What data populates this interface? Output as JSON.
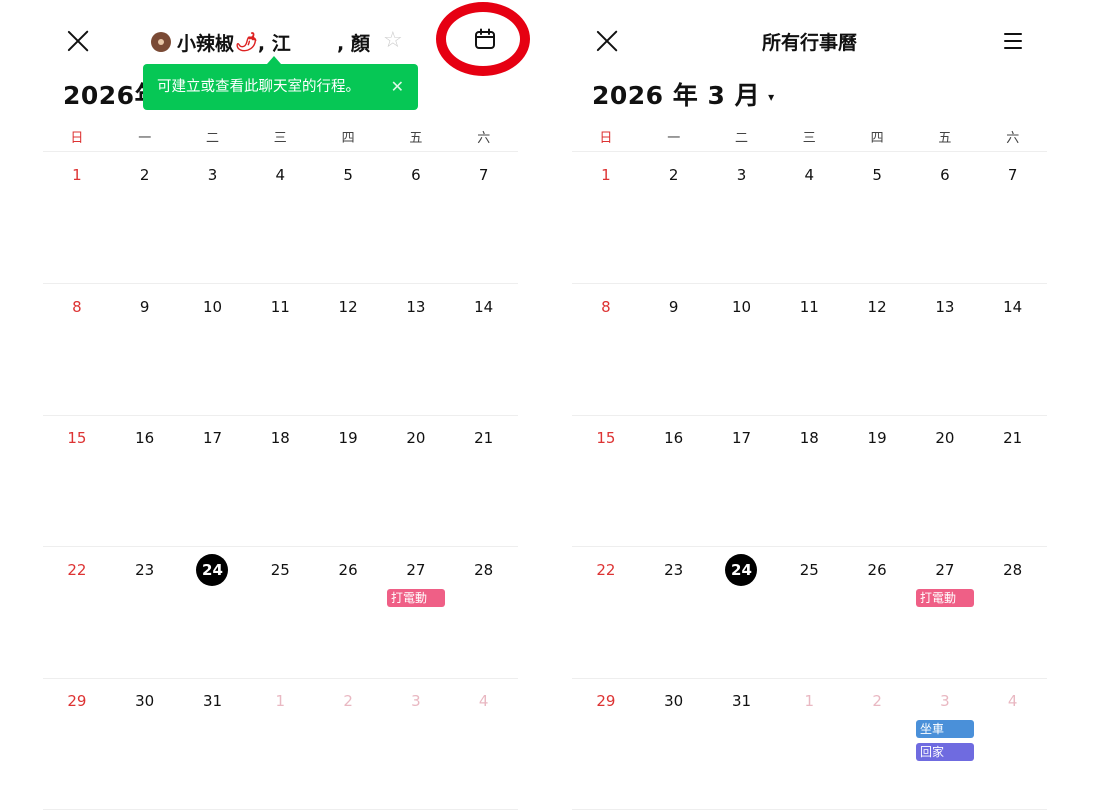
{
  "colors": {
    "today_bg": "#000000",
    "sunday": "#dd3333",
    "other_month": "#e9b8c2",
    "tooltip_bg": "#06c755",
    "highlight_ring": "#e60012",
    "event_pink": "#ef5f86",
    "event_blue": "#4a90d9",
    "event_purple": "#6f6be0"
  },
  "left": {
    "title": {
      "avatar_icon": "avatar-icon",
      "name1": "小辣椒",
      "pepper_icon": "🌶",
      "rest": ", 江       , 顏"
    },
    "star_icon": "star-icon",
    "calendar_icon": "calendar-icon",
    "month_label": "2026年",
    "tooltip": {
      "text": "可建立或查看此聊天室的行程。",
      "close": "✕"
    }
  },
  "right": {
    "title": "所有行事曆",
    "menu_icon": "menu-icon",
    "month_label": "2026 年 3 月",
    "dropdown_caret": "▾"
  },
  "weekdays": [
    "日",
    "一",
    "二",
    "三",
    "四",
    "五",
    "六"
  ],
  "weeks": [
    [
      {
        "d": "1"
      },
      {
        "d": "2"
      },
      {
        "d": "3"
      },
      {
        "d": "4"
      },
      {
        "d": "5"
      },
      {
        "d": "6"
      },
      {
        "d": "7"
      }
    ],
    [
      {
        "d": "8"
      },
      {
        "d": "9"
      },
      {
        "d": "10"
      },
      {
        "d": "11"
      },
      {
        "d": "12"
      },
      {
        "d": "13"
      },
      {
        "d": "14"
      }
    ],
    [
      {
        "d": "15"
      },
      {
        "d": "16"
      },
      {
        "d": "17"
      },
      {
        "d": "18"
      },
      {
        "d": "19"
      },
      {
        "d": "20"
      },
      {
        "d": "21"
      }
    ],
    [
      {
        "d": "22"
      },
      {
        "d": "23"
      },
      {
        "d": "24",
        "today": true
      },
      {
        "d": "25"
      },
      {
        "d": "26"
      },
      {
        "d": "27"
      },
      {
        "d": "28"
      }
    ],
    [
      {
        "d": "29"
      },
      {
        "d": "30"
      },
      {
        "d": "31"
      },
      {
        "d": "1",
        "other": true
      },
      {
        "d": "2",
        "other": true
      },
      {
        "d": "3",
        "other": true
      },
      {
        "d": "4",
        "other": true
      }
    ]
  ],
  "events_left": [
    {
      "week": 3,
      "day": 5,
      "slot": 0,
      "label": "打電動",
      "color": "#ef5f86"
    }
  ],
  "events_right": [
    {
      "week": 3,
      "day": 5,
      "slot": 0,
      "label": "打電動",
      "color": "#ef5f86"
    },
    {
      "week": 4,
      "day": 5,
      "slot": 0,
      "label": "坐車",
      "color": "#4a90d9"
    },
    {
      "week": 4,
      "day": 5,
      "slot": 1,
      "label": "回家",
      "color": "#6f6be0"
    }
  ]
}
